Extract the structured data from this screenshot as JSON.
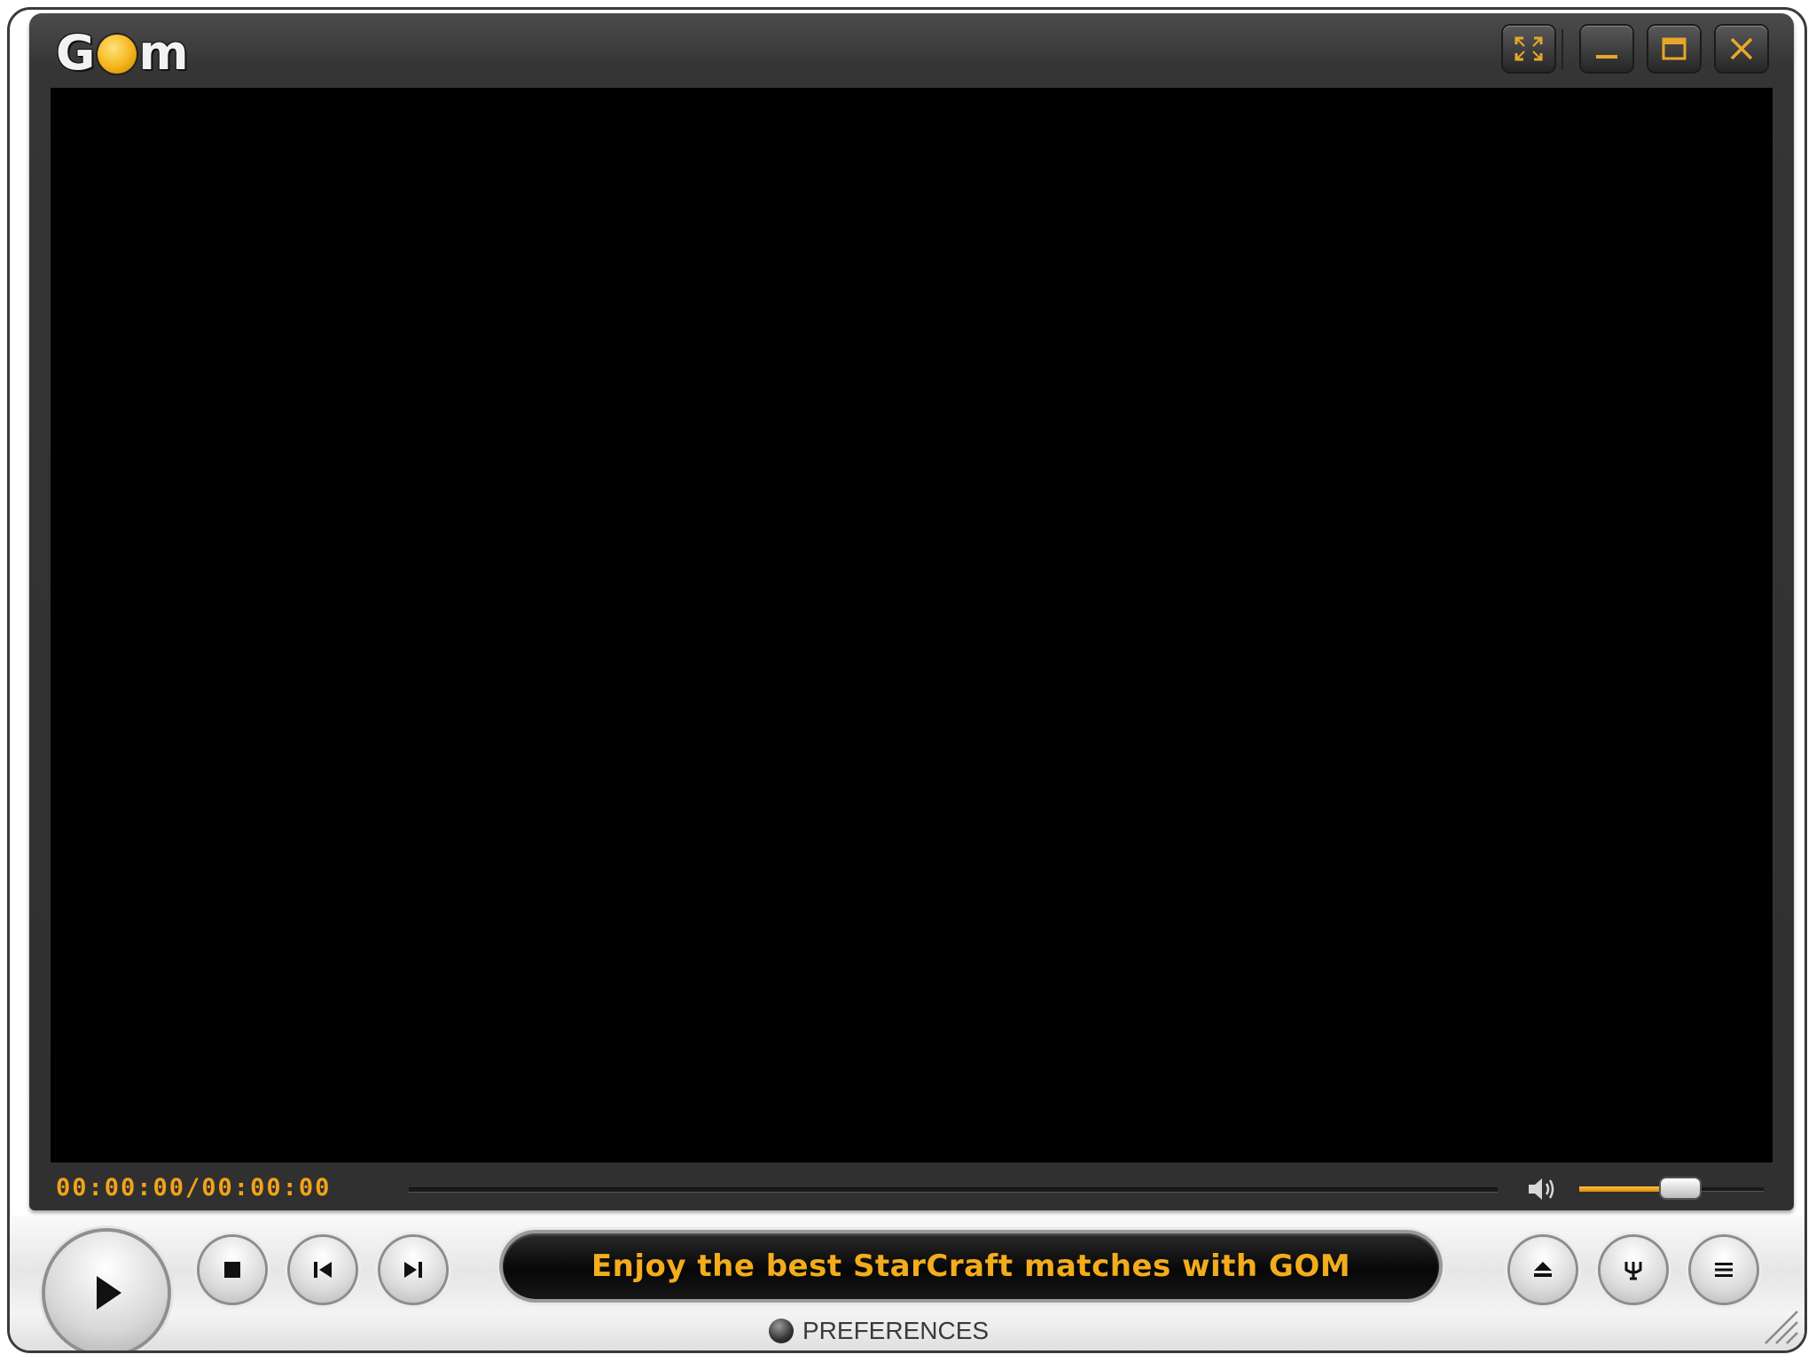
{
  "app": {
    "logo_left": "G",
    "logo_right": "m"
  },
  "titlebar": {
    "buttons": [
      "fullscreen-icon",
      "minimize-icon",
      "maximize-icon",
      "close-icon"
    ]
  },
  "playback": {
    "time_display": "00:00:00/00:00:00",
    "volume_level": 0.55
  },
  "controls": {
    "buttons": [
      "play-icon",
      "stop-icon",
      "previous-icon",
      "next-icon",
      "eject-icon",
      "equalizer-icon",
      "playlist-icon"
    ]
  },
  "banner": {
    "text": "Enjoy the best StarCraft matches with GOM"
  },
  "preferences": {
    "label": "PREFERENCES"
  },
  "colors": {
    "accent": "#f2ac1c",
    "frame": "#353535",
    "video": "#000000"
  }
}
